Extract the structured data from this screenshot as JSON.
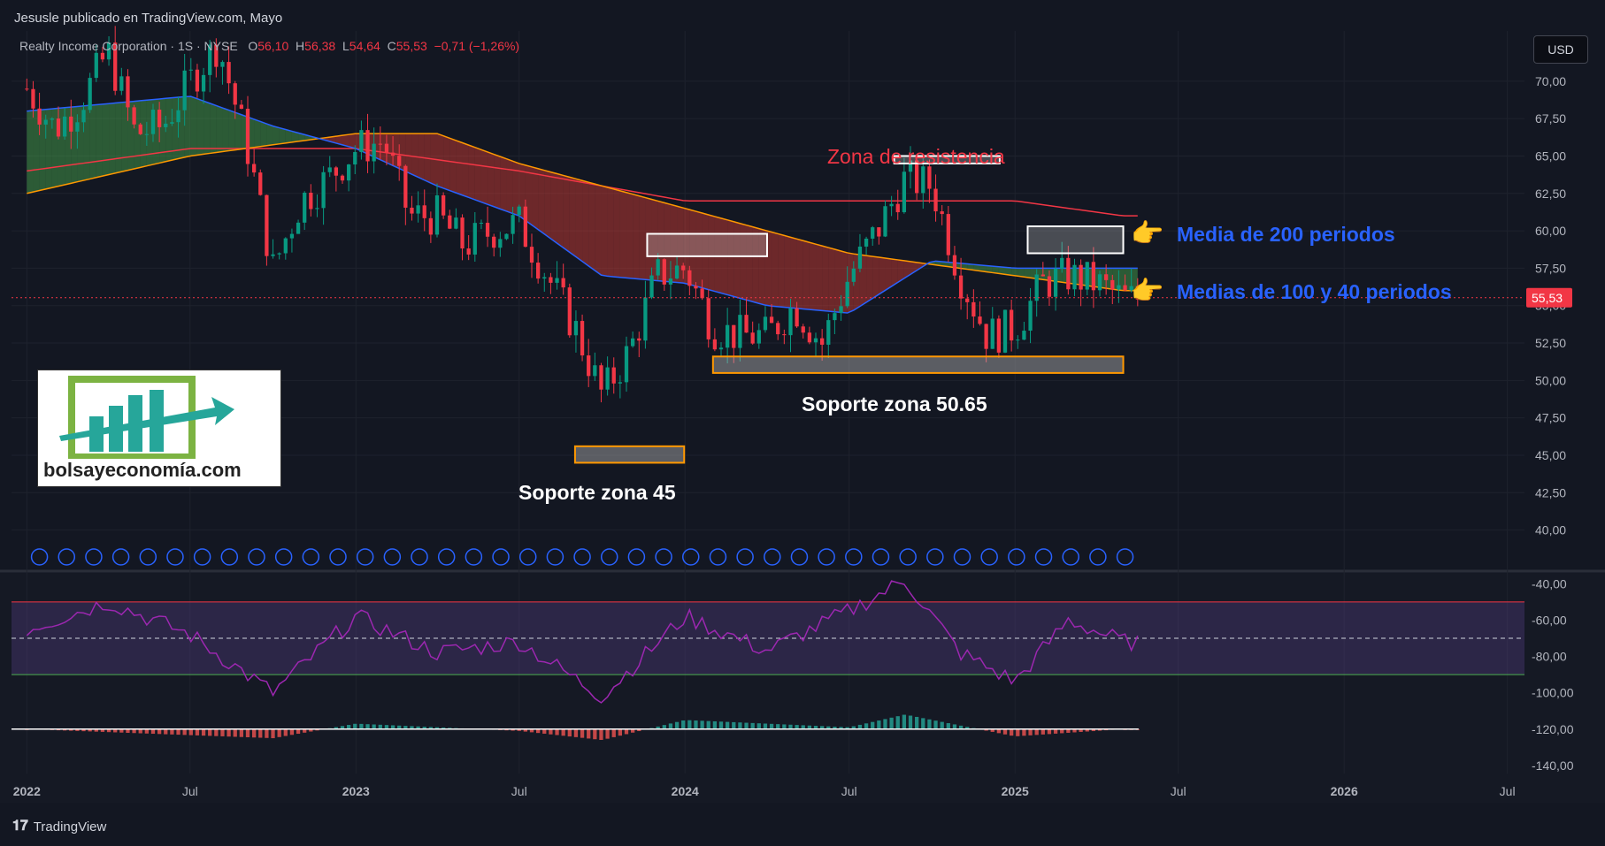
{
  "header": {
    "published_by": "Jesusle publicado en TradingView.com, Mayo"
  },
  "legend": {
    "symbol": "Realty Income Corporation · 1S · NYSE",
    "o_label": "O",
    "o": "56,10",
    "h_label": "H",
    "h": "56,38",
    "l_label": "L",
    "l": "54,64",
    "c_label": "C",
    "c": "55,53",
    "change": "−0,71 (−1,26%)"
  },
  "currency_button": "USD",
  "footer": {
    "brand": "TradingView"
  },
  "logo": {
    "text": "bolsayeconomía.com"
  },
  "annotations": {
    "resistance": "Zona de resistencia",
    "ma200": "Media de 200 periodos",
    "ma100_40": "Medias de 100 y 40 periodos",
    "support_50": "Soporte zona 50.65",
    "support_45": "Soporte zona 45",
    "pointer_emoji": "👉"
  },
  "colors": {
    "background": "#131722",
    "up": "#089981",
    "down": "#f23645",
    "ma40": "#2962ff",
    "ma100": "#ff9800",
    "ma200": "#f23645",
    "rsi": "#9c27b0",
    "support_box": "#ff9800",
    "annotation_blue": "#2962ff",
    "annotation_red": "#f23645"
  },
  "chart_data": [
    {
      "type": "candlestick",
      "title": "",
      "x_ticks": [
        "2022",
        "Jul",
        "2023",
        "Jul",
        "2024",
        "Jul",
        "2025",
        "Jul",
        "2026",
        "Jul"
      ],
      "x_tick_dates": [
        "2022-01-01",
        "2022-07-01",
        "2023-01-01",
        "2023-07-01",
        "2024-01-01",
        "2024-07-01",
        "2025-01-01",
        "2025-07-01",
        "2026-01-01",
        "2026-07-01"
      ],
      "y_ticks": [
        "40,00",
        "42,50",
        "45,00",
        "47,50",
        "50,00",
        "52,50",
        "55,00",
        "57,50",
        "60,00",
        "62,50",
        "65,00",
        "67,50",
        "70,00"
      ],
      "ylim": [
        38.5,
        72.0
      ],
      "current_price_label": "55,53",
      "current_price": 55.53,
      "series_close_weekly_approx": [
        {
          "date": "2022-01-01",
          "close": 69.5
        },
        {
          "date": "2022-02-01",
          "close": 66.8
        },
        {
          "date": "2022-03-01",
          "close": 68.5
        },
        {
          "date": "2022-04-01",
          "close": 72.0
        },
        {
          "date": "2022-05-01",
          "close": 66.5
        },
        {
          "date": "2022-06-01",
          "close": 67.0
        },
        {
          "date": "2022-07-01",
          "close": 70.0
        },
        {
          "date": "2022-08-01",
          "close": 72.5
        },
        {
          "date": "2022-09-01",
          "close": 66.0
        },
        {
          "date": "2022-10-01",
          "close": 57.5
        },
        {
          "date": "2022-11-01",
          "close": 62.0
        },
        {
          "date": "2022-12-01",
          "close": 63.5
        },
        {
          "date": "2023-01-01",
          "close": 65.5
        },
        {
          "date": "2023-02-01",
          "close": 66.0
        },
        {
          "date": "2023-03-01",
          "close": 61.0
        },
        {
          "date": "2023-04-01",
          "close": 61.0
        },
        {
          "date": "2023-05-01",
          "close": 59.0
        },
        {
          "date": "2023-06-01",
          "close": 60.0
        },
        {
          "date": "2023-07-01",
          "close": 60.5
        },
        {
          "date": "2023-08-01",
          "close": 57.0
        },
        {
          "date": "2023-09-01",
          "close": 53.5
        },
        {
          "date": "2023-10-01",
          "close": 49.0
        },
        {
          "date": "2023-11-01",
          "close": 52.0
        },
        {
          "date": "2023-12-01",
          "close": 57.0
        },
        {
          "date": "2024-01-01",
          "close": 57.5
        },
        {
          "date": "2024-02-01",
          "close": 53.5
        },
        {
          "date": "2024-03-01",
          "close": 53.0
        },
        {
          "date": "2024-04-01",
          "close": 53.0
        },
        {
          "date": "2024-05-01",
          "close": 55.0
        },
        {
          "date": "2024-06-01",
          "close": 52.5
        },
        {
          "date": "2024-07-01",
          "close": 57.0
        },
        {
          "date": "2024-08-01",
          "close": 60.0
        },
        {
          "date": "2024-09-01",
          "close": 63.5
        },
        {
          "date": "2024-10-01",
          "close": 63.0
        },
        {
          "date": "2024-11-01",
          "close": 57.0
        },
        {
          "date": "2024-12-01",
          "close": 53.0
        },
        {
          "date": "2025-01-01",
          "close": 53.5
        },
        {
          "date": "2025-02-01",
          "close": 56.5
        },
        {
          "date": "2025-03-01",
          "close": 57.0
        },
        {
          "date": "2025-04-01",
          "close": 56.5
        },
        {
          "date": "2025-05-01",
          "close": 55.5
        }
      ],
      "ma40_approx": [
        {
          "date": "2022-01-01",
          "value": 68.0
        },
        {
          "date": "2022-07-01",
          "value": 69.0
        },
        {
          "date": "2022-10-01",
          "value": 67.0
        },
        {
          "date": "2023-01-01",
          "value": 65.5
        },
        {
          "date": "2023-04-01",
          "value": 63.0
        },
        {
          "date": "2023-07-01",
          "value": 61.0
        },
        {
          "date": "2023-10-01",
          "value": 57.0
        },
        {
          "date": "2024-01-01",
          "value": 56.5
        },
        {
          "date": "2024-04-01",
          "value": 55.0
        },
        {
          "date": "2024-07-01",
          "value": 54.5
        },
        {
          "date": "2024-10-01",
          "value": 58.0
        },
        {
          "date": "2025-01-01",
          "value": 57.5
        },
        {
          "date": "2025-05-01",
          "value": 57.5
        }
      ],
      "ma100_approx": [
        {
          "date": "2022-01-01",
          "value": 62.5
        },
        {
          "date": "2022-07-01",
          "value": 65.0
        },
        {
          "date": "2023-01-01",
          "value": 66.5
        },
        {
          "date": "2023-04-01",
          "value": 66.5
        },
        {
          "date": "2023-07-01",
          "value": 64.5
        },
        {
          "date": "2024-01-01",
          "value": 61.5
        },
        {
          "date": "2024-07-01",
          "value": 58.5
        },
        {
          "date": "2025-01-01",
          "value": 57.0
        },
        {
          "date": "2025-05-01",
          "value": 56.0
        }
      ],
      "ma200_approx": [
        {
          "date": "2022-01-01",
          "value": 64.0
        },
        {
          "date": "2022-07-01",
          "value": 65.5
        },
        {
          "date": "2023-01-01",
          "value": 65.5
        },
        {
          "date": "2023-07-01",
          "value": 64.0
        },
        {
          "date": "2024-01-01",
          "value": 62.0
        },
        {
          "date": "2024-07-01",
          "value": 62.0
        },
        {
          "date": "2025-01-01",
          "value": 62.0
        },
        {
          "date": "2025-05-01",
          "value": 61.0
        }
      ],
      "zones": [
        {
          "kind": "resistance",
          "date_start": "2024-08-20",
          "date_end": "2024-12-15",
          "y_low": 64.5,
          "y_high": 65.0
        },
        {
          "kind": "resistance",
          "date_start": "2023-11-20",
          "date_end": "2024-04-01",
          "y_low": 58.3,
          "y_high": 59.8
        },
        {
          "kind": "resistance",
          "date_start": "2025-01-15",
          "date_end": "2025-05-01",
          "y_low": 58.5,
          "y_high": 60.3
        },
        {
          "kind": "support",
          "date_start": "2024-02-01",
          "date_end": "2025-05-01",
          "y_low": 50.5,
          "y_high": 51.6
        },
        {
          "kind": "support",
          "date_start": "2023-09-01",
          "date_end": "2023-12-31",
          "y_low": 44.5,
          "y_high": 45.6
        }
      ]
    },
    {
      "type": "line",
      "title": "",
      "y_ticks": [
        "-40,00",
        "-60,00",
        "-80,00",
        "-100,00",
        "-120,00",
        "-140,00"
      ],
      "ylim": [
        -142,
        -35
      ],
      "rsi_band": [
        -90,
        -50
      ],
      "rsi_mid": -70,
      "rsi_values_approx": [
        {
          "date": "2022-01-01",
          "value": -65
        },
        {
          "date": "2022-04-01",
          "value": -50
        },
        {
          "date": "2022-07-01",
          "value": -68
        },
        {
          "date": "2022-10-01",
          "value": -100
        },
        {
          "date": "2023-01-01",
          "value": -58
        },
        {
          "date": "2023-04-01",
          "value": -78
        },
        {
          "date": "2023-07-01",
          "value": -72
        },
        {
          "date": "2023-10-01",
          "value": -102
        },
        {
          "date": "2024-01-01",
          "value": -58
        },
        {
          "date": "2024-04-01",
          "value": -77
        },
        {
          "date": "2024-07-01",
          "value": -55
        },
        {
          "date": "2024-09-01",
          "value": -38
        },
        {
          "date": "2024-11-01",
          "value": -78
        },
        {
          "date": "2025-01-01",
          "value": -94
        },
        {
          "date": "2025-03-01",
          "value": -60
        },
        {
          "date": "2025-05-01",
          "value": -72
        }
      ],
      "macd_hist_approx": [
        {
          "date": "2022-01-01",
          "value": -120
        },
        {
          "date": "2022-10-01",
          "value": -125
        },
        {
          "date": "2023-01-01",
          "value": -117
        },
        {
          "date": "2023-07-01",
          "value": -121
        },
        {
          "date": "2023-10-01",
          "value": -126
        },
        {
          "date": "2024-01-01",
          "value": -115
        },
        {
          "date": "2024-07-01",
          "value": -119
        },
        {
          "date": "2024-09-01",
          "value": -112
        },
        {
          "date": "2025-01-01",
          "value": -124
        },
        {
          "date": "2025-05-01",
          "value": -120
        }
      ]
    }
  ]
}
